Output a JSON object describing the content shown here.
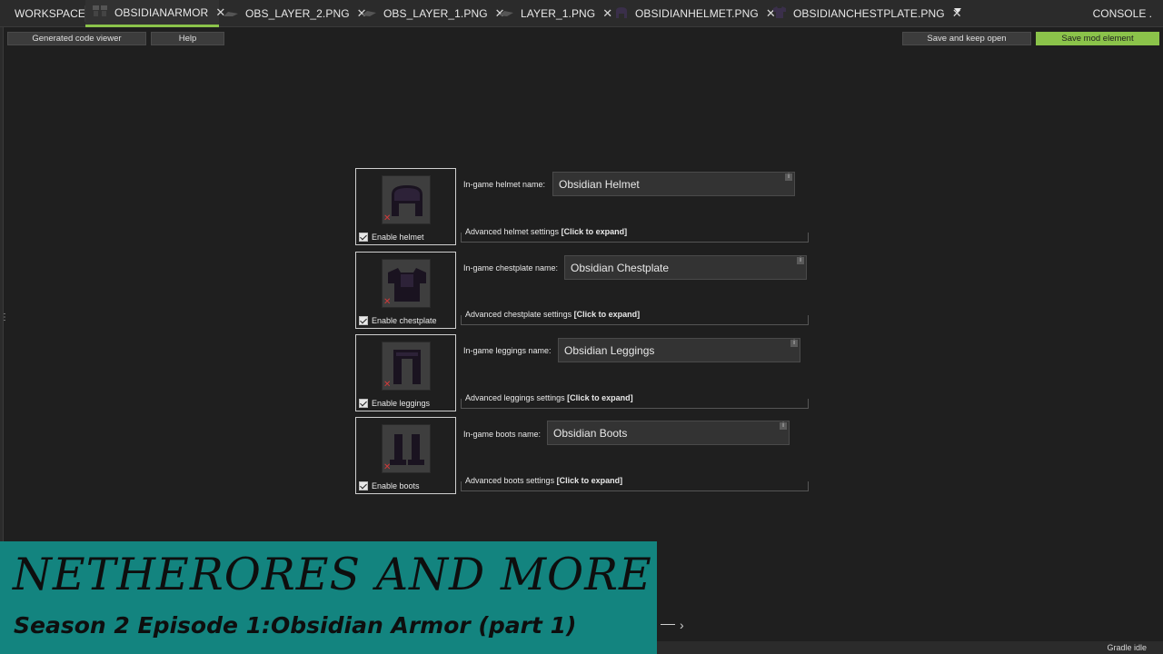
{
  "tabs": {
    "workspace": "WORKSPACE",
    "items": [
      {
        "label": "OBSIDIANARMOR",
        "icon": "armor-set-icon"
      },
      {
        "label": "OBS_LAYER_2.PNG",
        "icon": "texture-layer-icon"
      },
      {
        "label": "OBS_LAYER_1.PNG",
        "icon": "texture-layer-icon"
      },
      {
        "label": "LAYER_1.PNG",
        "icon": "texture-layer-icon"
      },
      {
        "label": "OBSIDIANHELMET.PNG",
        "icon": "helmet-icon"
      },
      {
        "label": "OBSIDIANCHESTPLATE.PNG",
        "icon": "chestplate-icon"
      }
    ],
    "close_glyph": "✕",
    "console": "CONSOLE ."
  },
  "toolbar": {
    "code_viewer": "Generated code viewer",
    "help": "Help",
    "save_keep_open": "Save and keep open",
    "save_mod_element": "Save mod element"
  },
  "armor": {
    "helmet": {
      "enable": "Enable helmet",
      "name_label": "In-game helmet name:",
      "name_value": "Obsidian  Helmet",
      "adv_label": "Advanced helmet settings",
      "expand": "[Click to expand]"
    },
    "chestplate": {
      "enable": "Enable chestplate",
      "name_label": "In-game chestplate name:",
      "name_value": "Obsidian  Chestplate",
      "adv_label": "Advanced chestplate settings",
      "expand": "[Click to expand]"
    },
    "leggings": {
      "enable": "Enable leggings",
      "name_label": "In-game leggings name:",
      "name_value": "Obsidian  Leggings",
      "adv_label": "Advanced leggings settings",
      "expand": "[Click to expand]"
    },
    "boots": {
      "enable": "Enable boots",
      "name_label": "In-game boots name:",
      "name_value": "Obsidian  Boots",
      "adv_label": "Advanced boots settings",
      "expand": "[Click to expand]"
    },
    "info_glyph": "i",
    "remove_glyph": "✕"
  },
  "banner": {
    "title": "NETHERORES AND MORE",
    "subtitle": "Season 2 Episode 1:Obsidian Armor (part 1)"
  },
  "status": "Gradle idle",
  "colors": {
    "accent_green": "#8bc34a",
    "banner_teal": "#13847f",
    "background": "#1f1f1f"
  }
}
